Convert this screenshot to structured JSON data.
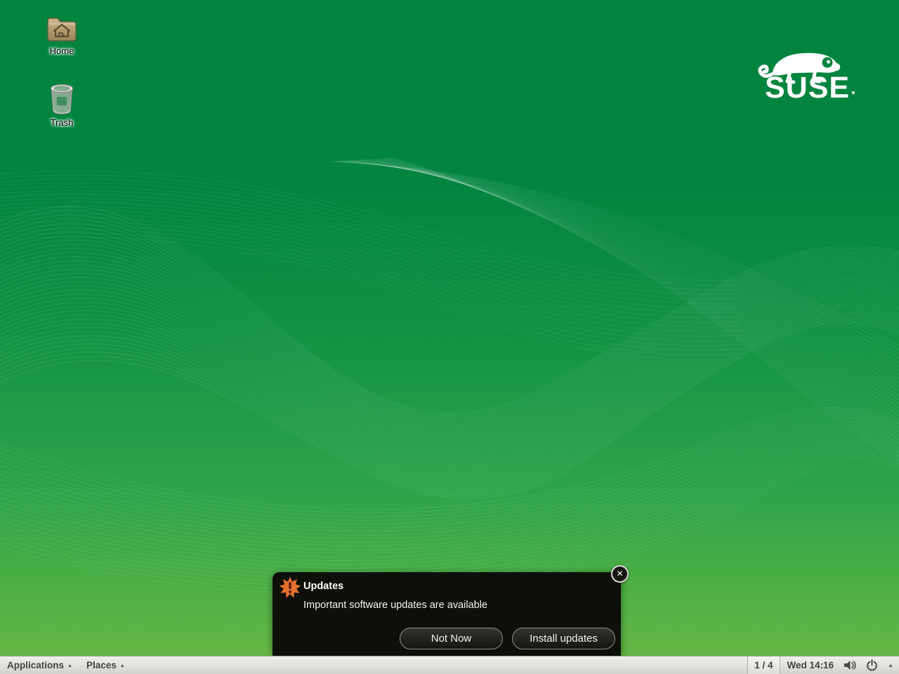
{
  "desktop": {
    "icons": [
      {
        "label": "Home"
      },
      {
        "label": "Trash"
      }
    ],
    "logo": {
      "text": "SUSE"
    }
  },
  "notification": {
    "title": "Updates",
    "message": "Important software updates are available",
    "not_now_label": "Not Now",
    "install_label": "Install updates",
    "close_glyph": "✕"
  },
  "panel": {
    "applications_label": "Applications",
    "places_label": "Places",
    "menu_arrow": "▲",
    "workspace": "1 / 4",
    "clock": "Wed 14:16",
    "tray_arrow": "▲"
  },
  "colors": {
    "bg_top": "#00843e",
    "bg_bottom": "#65b545",
    "alert_orange": "#e8702d",
    "panel_gray": "#dededa",
    "notif_bg": "#0d0f09"
  }
}
